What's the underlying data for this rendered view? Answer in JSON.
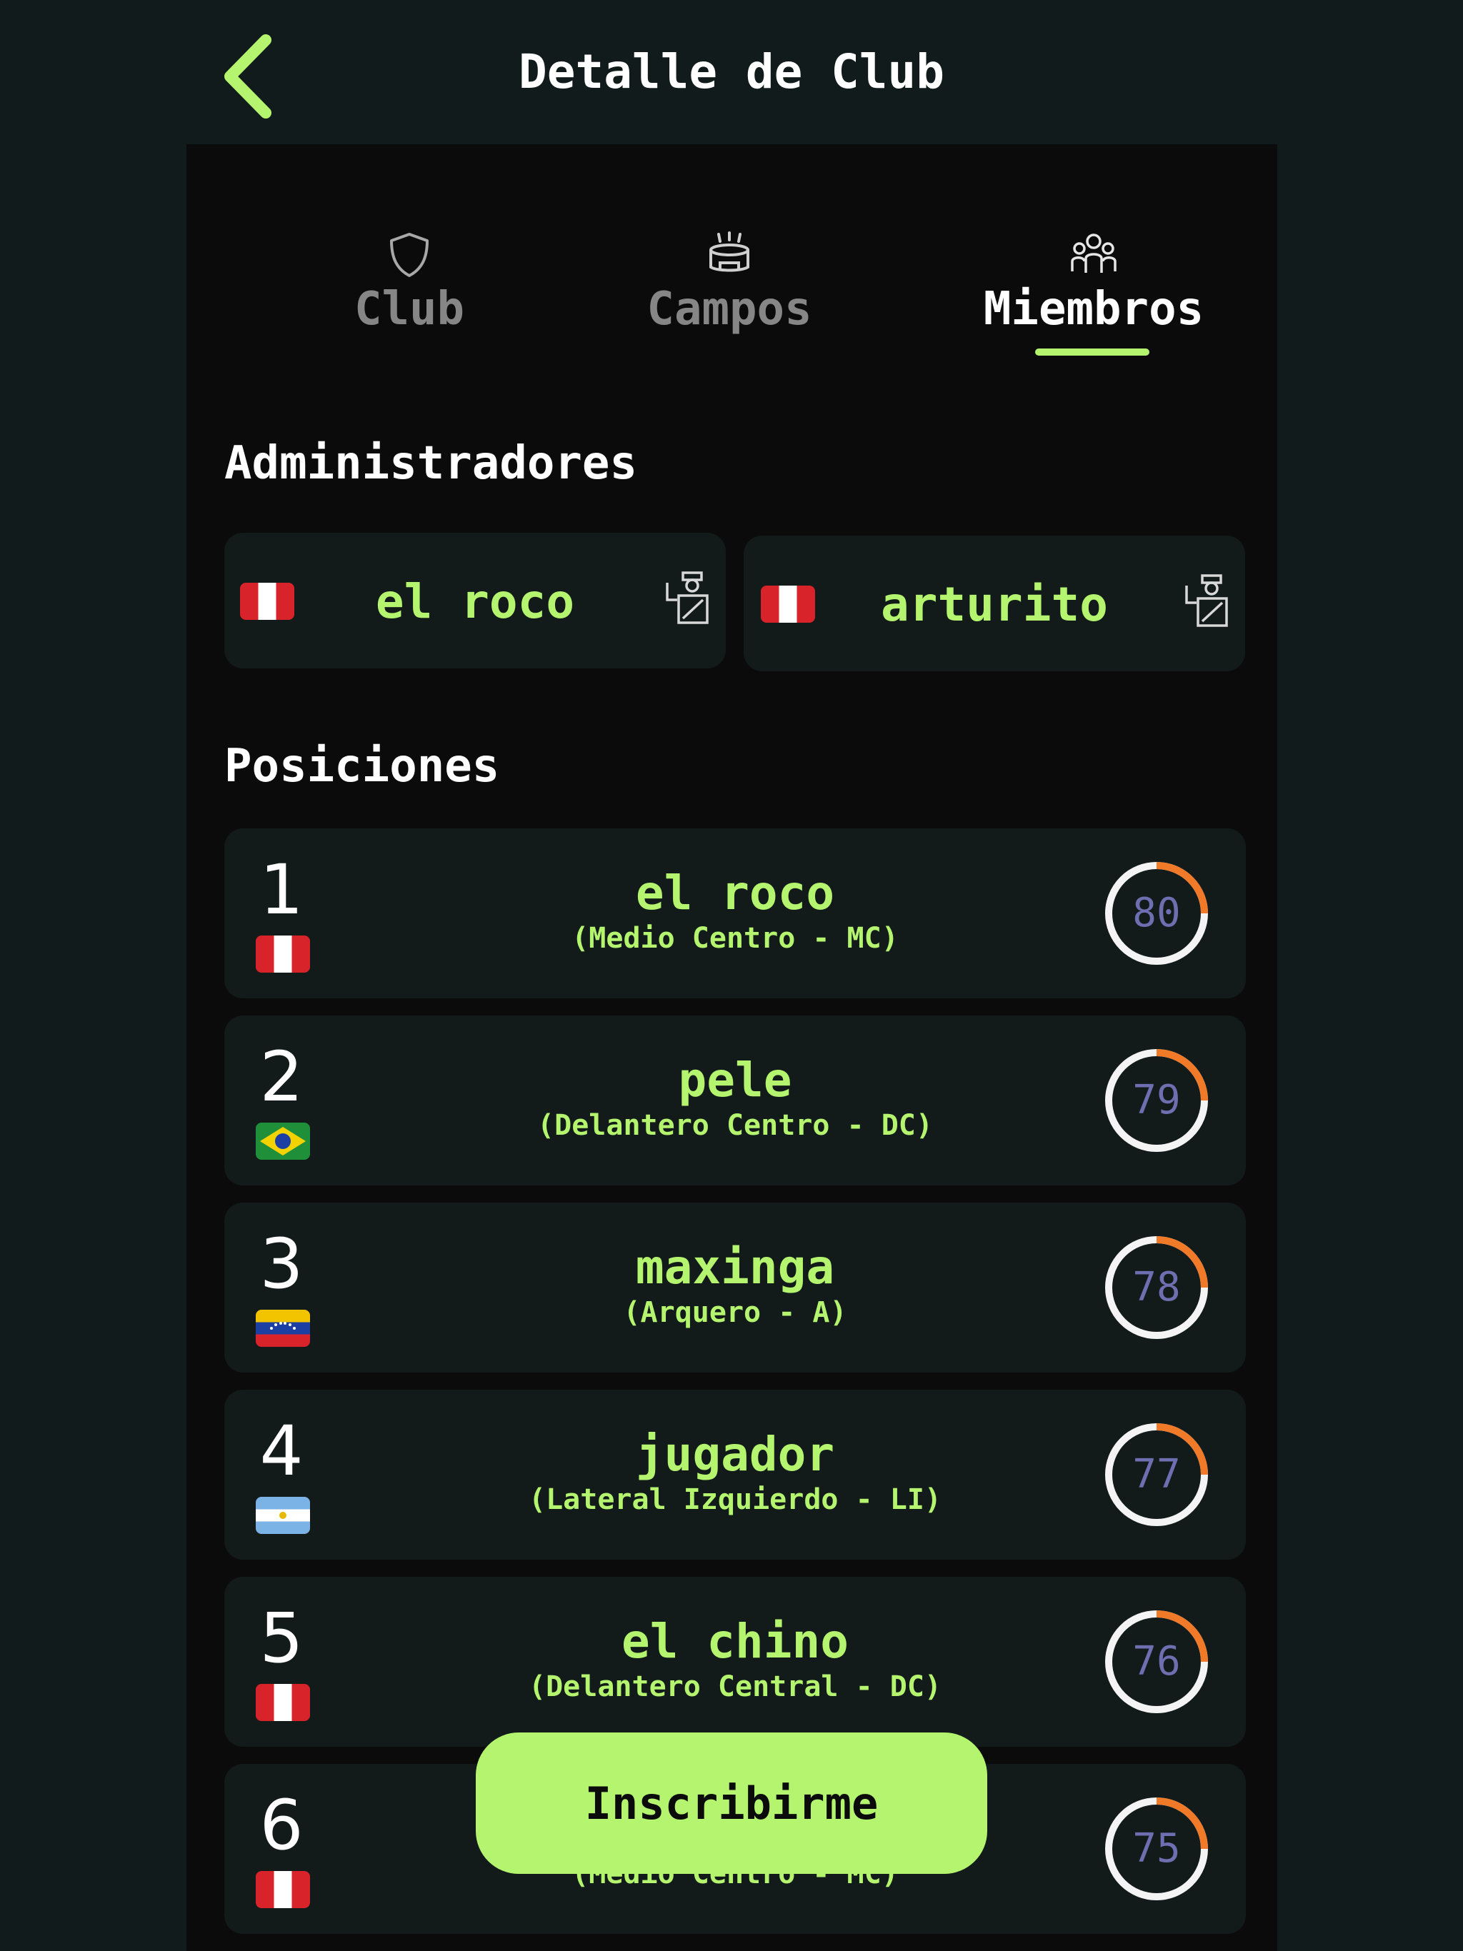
{
  "header": {
    "title": "Detalle de Club"
  },
  "tabs": [
    {
      "label": "Club",
      "icon": "shield-icon",
      "active": false
    },
    {
      "label": "Campos",
      "icon": "stadium-icon",
      "active": false
    },
    {
      "label": "Miembros",
      "icon": "group-icon",
      "active": true
    }
  ],
  "admins_section": {
    "title": "Administradores",
    "admins": [
      {
        "name": "el roco",
        "flag": "peru",
        "icon": "coach-icon"
      },
      {
        "name": "arturito",
        "flag": "peru",
        "icon": "coach-icon"
      }
    ]
  },
  "positions_section": {
    "title": "Posiciones",
    "players": [
      {
        "rank": "1",
        "name": "el roco",
        "position": "(Medio Centro - MC)",
        "flag": "peru",
        "rating": "80"
      },
      {
        "rank": "2",
        "name": "pele",
        "position": "(Delantero Centro - DC)",
        "flag": "brazil",
        "rating": "79"
      },
      {
        "rank": "3",
        "name": "maxinga",
        "position": "(Arquero - A)",
        "flag": "venezuela",
        "rating": "78"
      },
      {
        "rank": "4",
        "name": "jugador",
        "position": "(Lateral Izquierdo - LI)",
        "flag": "argentina",
        "rating": "77"
      },
      {
        "rank": "5",
        "name": "el chino",
        "position": "(Delantero Central - DC)",
        "flag": "peru",
        "rating": "76"
      },
      {
        "rank": "6",
        "name": "",
        "position": "(Medio Centro - MC)",
        "flag": "peru",
        "rating": "75"
      }
    ]
  },
  "cta": {
    "label": "Inscribirme"
  },
  "colors": {
    "accent": "#b4f46e",
    "rating_arc": "#f07a28",
    "rating_text": "#6e6fb0",
    "background": "#121b1b"
  }
}
